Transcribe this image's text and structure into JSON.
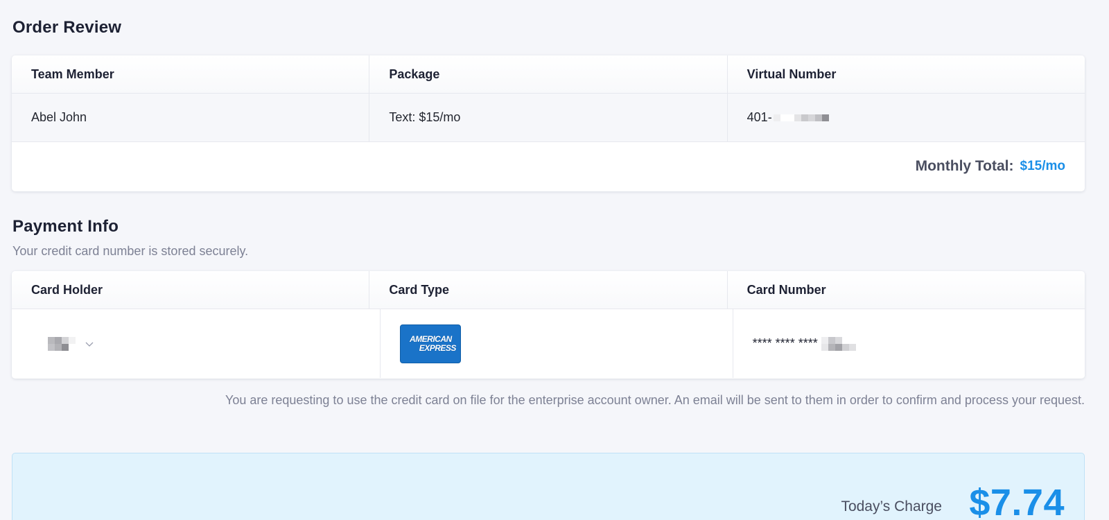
{
  "order_review": {
    "title": "Order Review",
    "columns": [
      "Team Member",
      "Package",
      "Virtual Number"
    ],
    "row": {
      "team_member": "Abel John",
      "package": "Text: $15/mo",
      "virtual_number_prefix": "401-"
    },
    "monthly_total_label": "Monthly Total:",
    "monthly_total_value": "$15/mo"
  },
  "payment_info": {
    "title": "Payment Info",
    "subtitle": "Your credit card number is stored securely.",
    "columns": [
      "Card Holder",
      "Card Type",
      "Card Number"
    ],
    "card_type_lines": [
      "AMERICAN",
      "EXPRESS"
    ],
    "card_number_prefix": "**** **** **** "
  },
  "notice": "You are requesting to use the credit card on file for the enterprise account owner. An email will be sent to them in order to confirm and process your request.",
  "today_charge": {
    "label": "Today’s Charge",
    "value": "$7.74"
  },
  "colors": {
    "accent": "#1a8fe8",
    "amex_blue": "#1a73c8",
    "charge_bg": "#e1f3fd"
  }
}
